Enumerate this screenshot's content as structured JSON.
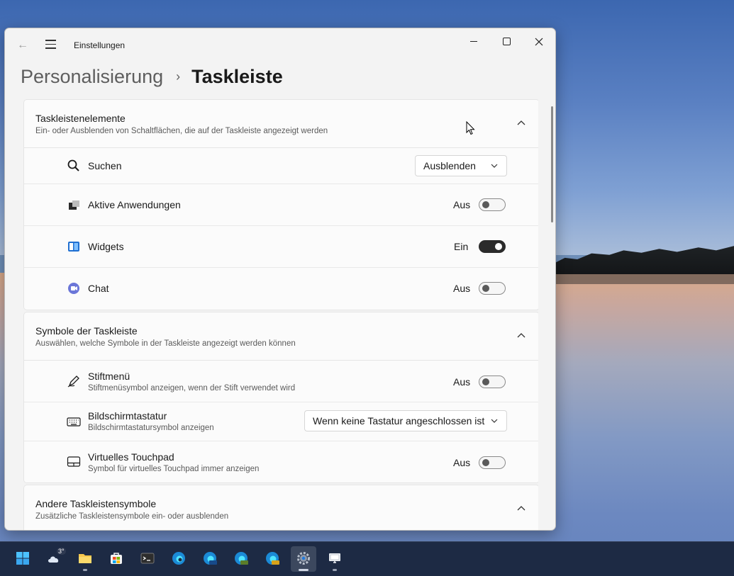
{
  "window": {
    "title": "Einstellungen",
    "back_label": "←"
  },
  "breadcrumb": {
    "parent": "Personalisierung",
    "separator": "›",
    "current": "Taskleiste"
  },
  "sections": {
    "elements": {
      "title": "Taskleistenelemente",
      "description": "Ein- oder Ausblenden von Schaltflächen, die auf der Taskleiste angezeigt werden",
      "rows": {
        "search": {
          "label": "Suchen",
          "value": "Ausblenden"
        },
        "task_view": {
          "label": "Aktive Anwendungen",
          "state": "Aus",
          "on": false
        },
        "widgets": {
          "label": "Widgets",
          "state": "Ein",
          "on": true
        },
        "chat": {
          "label": "Chat",
          "state": "Aus",
          "on": false
        }
      }
    },
    "corner_icons": {
      "title": "Symbole der Taskleiste",
      "description": "Auswählen, welche Symbole in der Taskleiste angezeigt werden können",
      "rows": {
        "pen": {
          "label": "Stiftmenü",
          "sub": "Stiftmenüsymbol anzeigen, wenn der Stift verwendet wird",
          "state": "Aus",
          "on": false
        },
        "keyboard": {
          "label": "Bildschirmtastatur",
          "sub": "Bildschirmtastatursymbol anzeigen",
          "value": "Wenn keine Tastatur angeschlossen ist"
        },
        "touchpad": {
          "label": "Virtuelles Touchpad",
          "sub": "Symbol für virtuelles Touchpad immer anzeigen",
          "state": "Aus",
          "on": false
        }
      }
    },
    "other": {
      "title": "Andere Taskleistensymbole",
      "description": "Zusätzliche Taskleistensymbole ein- oder ausblenden"
    }
  },
  "taskbar": {
    "weather_temp": "3°",
    "items": [
      "start-icon",
      "weather-icon",
      "file-explorer-icon",
      "store-icon",
      "terminal-icon",
      "edge-icon",
      "edge-beta-icon",
      "edge-dev-icon",
      "edge-canary-icon",
      "settings-icon",
      "remote-desktop-icon"
    ]
  },
  "colors": {
    "accent_toggle_on": "#2b2b2b",
    "window_bg": "#f3f3f3",
    "card_bg": "#fbfbfb",
    "taskbar_bg": "#1d2a44"
  }
}
